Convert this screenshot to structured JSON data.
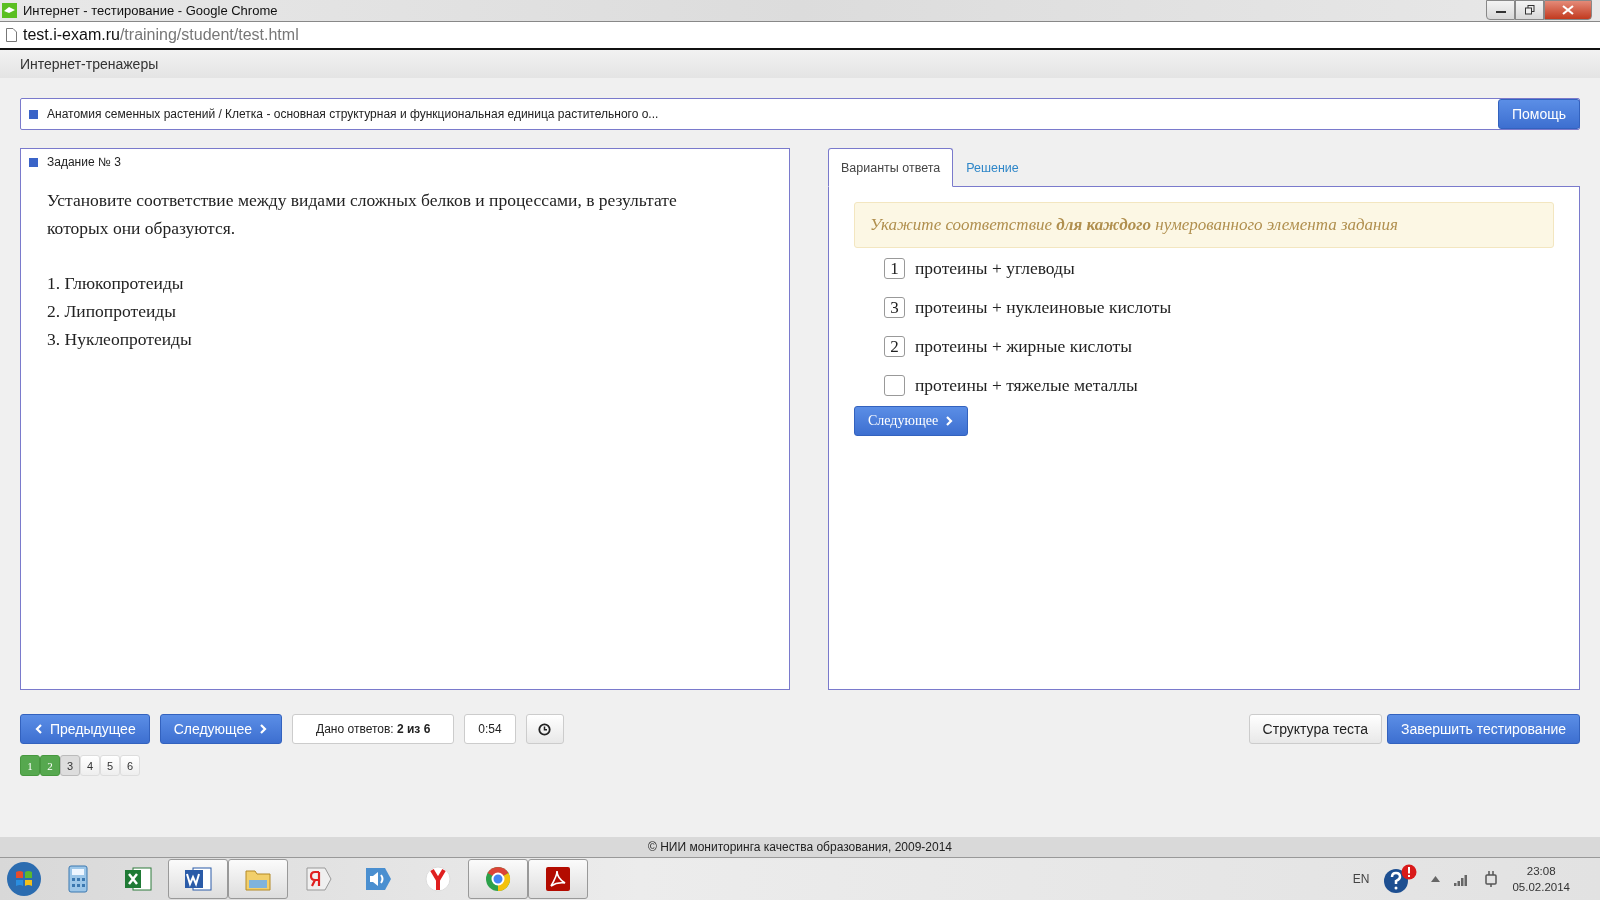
{
  "window": {
    "title": "Интернет - тестирование - Google Chrome"
  },
  "address_bar": {
    "domain": "test.i-exam.ru",
    "path": "/training/student/test.html"
  },
  "app_header": {
    "title": "Интернет-тренажеры"
  },
  "breadcrumb": {
    "text": "Анатомия семенных растений / Клетка - основная структурная и функциональная единица растительного о...",
    "help_button": "Помощь"
  },
  "task": {
    "heading": "Задание № 3",
    "question": "Установите соответствие между видами сложных белков и процессами, в результате которых они образуются.",
    "items": [
      "1. Глюкопротеиды",
      "2. Липопротеиды",
      "3. Нуклеопротеиды"
    ]
  },
  "tabs": [
    {
      "label": "Варианты ответа",
      "selected": true
    },
    {
      "label": "Решение",
      "selected": false
    }
  ],
  "answer": {
    "hint": "Укажите соответствие **для каждого** нумерованного элемента задания",
    "options": [
      {
        "value": "1",
        "label": "протеины + углеводы"
      },
      {
        "value": "3",
        "label": "протеины + нуклеиновые кислоты"
      },
      {
        "value": "2",
        "label": "протеины + жирные кислоты"
      },
      {
        "label": "протеины + тяжелые металлы"
      }
    ],
    "next_button": "Следующее"
  },
  "nav": {
    "prev_button": "Предыдущее",
    "next_button": "Следующее",
    "answered": "Дано ответов: **2 из 6**",
    "timer": "0:54"
  },
  "right_buttons": [
    {
      "label": "Структура теста",
      "kind": "default"
    },
    {
      "label": "Завершить тестирование",
      "kind": "primary"
    }
  ],
  "pages": [
    {
      "label": "1",
      "answered": true,
      "selected": false
    },
    {
      "label": "2",
      "answered": true,
      "selected": false
    },
    {
      "label": "3",
      "answered": false,
      "selected": true
    },
    {
      "label": "4",
      "answered": false,
      "selected": false
    },
    {
      "label": "5",
      "answered": false,
      "selected": false
    },
    {
      "label": "6",
      "answered": false,
      "selected": false
    }
  ],
  "footer": "© НИИ мониторинга качества образования, 2009-2014",
  "taskbar": {
    "apps": [
      {
        "kind": "calculator",
        "open": false
      },
      {
        "kind": "spreadsheet",
        "open": false
      },
      {
        "kind": "document",
        "open": true
      },
      {
        "kind": "folder",
        "open": true
      },
      {
        "kind": "ya",
        "open": false
      },
      {
        "kind": "speaker",
        "open": false
      },
      {
        "kind": "ybrowser",
        "open": false
      },
      {
        "kind": "chrome",
        "open": true
      },
      {
        "kind": "pdf",
        "open": true
      }
    ],
    "language": "EN",
    "time": "23:08",
    "date": "05.02.2014"
  }
}
